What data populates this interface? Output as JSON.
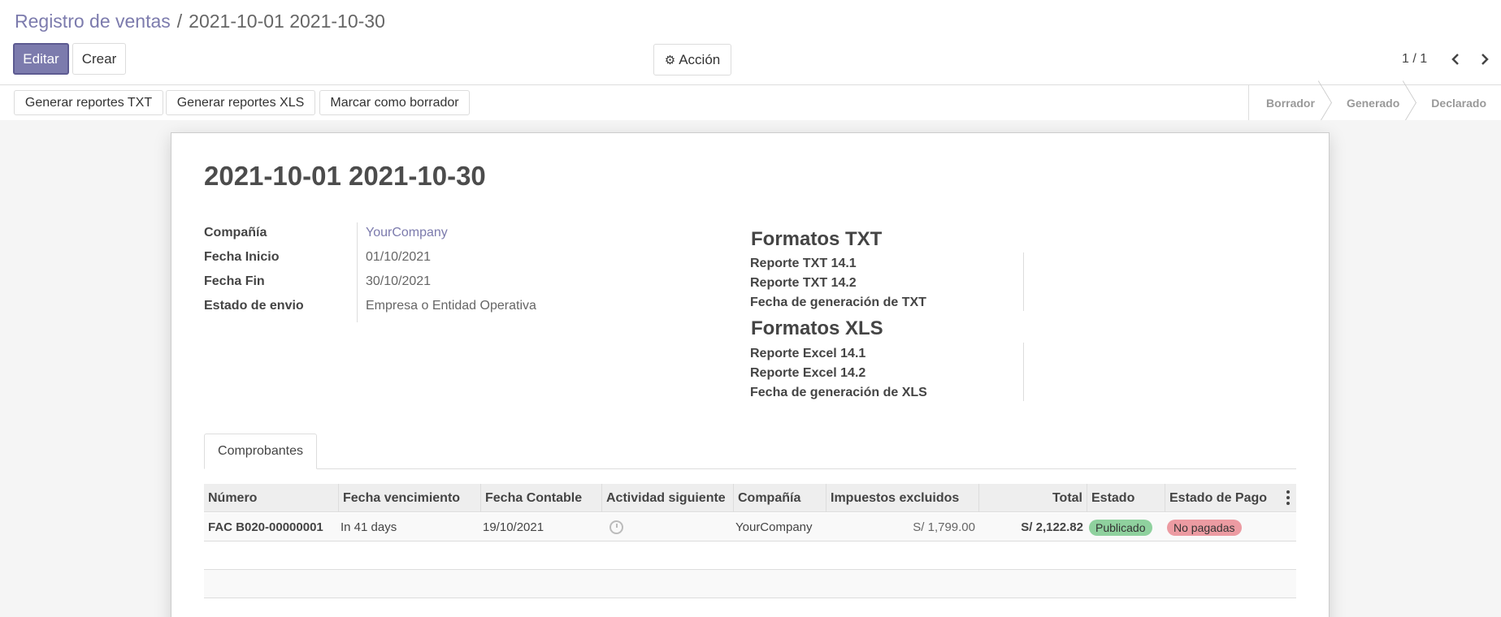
{
  "breadcrumb": {
    "parent": "Registro de ventas",
    "separator": "/",
    "current": "2021-10-01 2021-10-30"
  },
  "toolbar": {
    "edit_label": "Editar",
    "create_label": "Crear",
    "action_label": "Acción",
    "pager": "1 / 1"
  },
  "header_buttons": {
    "txt": "Generar reportes TXT",
    "xls": "Generar reportes XLS",
    "draft": "Marcar como borrador"
  },
  "stages": [
    "Borrador",
    "Generado",
    "Declarado"
  ],
  "record": {
    "title": "2021-10-01 2021-10-30",
    "fields": [
      {
        "label": "Compañía",
        "value": "YourCompany",
        "is_link": true
      },
      {
        "label": "Fecha Inicio",
        "value": "01/10/2021",
        "is_link": false
      },
      {
        "label": "Fecha Fin",
        "value": "30/10/2021",
        "is_link": false
      },
      {
        "label": "Estado de envio",
        "value": "Empresa o Entidad Operativa",
        "is_link": false
      }
    ],
    "txt_section": {
      "title": "Formatos TXT",
      "labels": [
        "Reporte TXT 14.1",
        "Reporte TXT 14.2",
        "Fecha de generación de TXT"
      ]
    },
    "xls_section": {
      "title": "Formatos XLS",
      "labels": [
        "Reporte Excel 14.1",
        "Reporte Excel 14.2",
        "Fecha de generación de XLS"
      ]
    }
  },
  "tabs": {
    "active": "Comprobantes"
  },
  "table": {
    "headers": [
      "Número",
      "Fecha vencimiento",
      "Fecha Contable",
      "Actividad siguiente",
      "Compañía",
      "Impuestos excluidos",
      "Total",
      "Estado",
      "Estado de Pago"
    ],
    "rows": [
      {
        "numero": "FAC B020-00000001",
        "vencimiento": "In 41 days",
        "fecha_contable": "19/10/2021",
        "actividad": "clock-icon",
        "compania": "YourCompany",
        "impuestos_excluidos": "S/ 1,799.00",
        "total": "S/ 2,122.82",
        "estado": "Publicado",
        "estado_pago": "No pagadas"
      }
    ]
  },
  "colors": {
    "primary": "#7c7bad",
    "badge_success": "#8fd19e",
    "badge_danger": "#ec9ba2"
  }
}
